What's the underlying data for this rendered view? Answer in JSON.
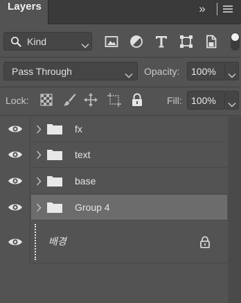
{
  "panel": {
    "tab_title": "Layers",
    "collapse_glyph": "»"
  },
  "filter": {
    "kind_label": "Kind",
    "icons": [
      "image-filter-icon",
      "adjustment-filter-icon",
      "type-filter-icon",
      "shape-filter-icon",
      "smart-object-filter-icon"
    ],
    "toggle_on": true
  },
  "blend": {
    "mode": "Pass Through",
    "opacity_label": "Opacity:",
    "opacity_value": "100%"
  },
  "lock": {
    "label": "Lock:",
    "icons": [
      "lock-transparent-pixels-icon",
      "lock-image-pixels-icon",
      "lock-position-icon",
      "lock-artboard-icon",
      "lock-all-icon"
    ],
    "fill_label": "Fill:",
    "fill_value": "100%"
  },
  "layers": [
    {
      "name": "fx",
      "type": "group",
      "visible": true,
      "selected": false
    },
    {
      "name": "text",
      "type": "group",
      "visible": true,
      "selected": false
    },
    {
      "name": "base",
      "type": "group",
      "visible": true,
      "selected": false
    },
    {
      "name": "Group 4",
      "type": "group",
      "visible": true,
      "selected": true
    }
  ],
  "background_layer": {
    "name": "배경",
    "visible": true,
    "locked": true
  },
  "colors": {
    "panel_bg": "#535353",
    "tab_bar_bg": "#3a3a3a",
    "selected_row": "#6c6c6c",
    "input_bg": "#454545"
  }
}
